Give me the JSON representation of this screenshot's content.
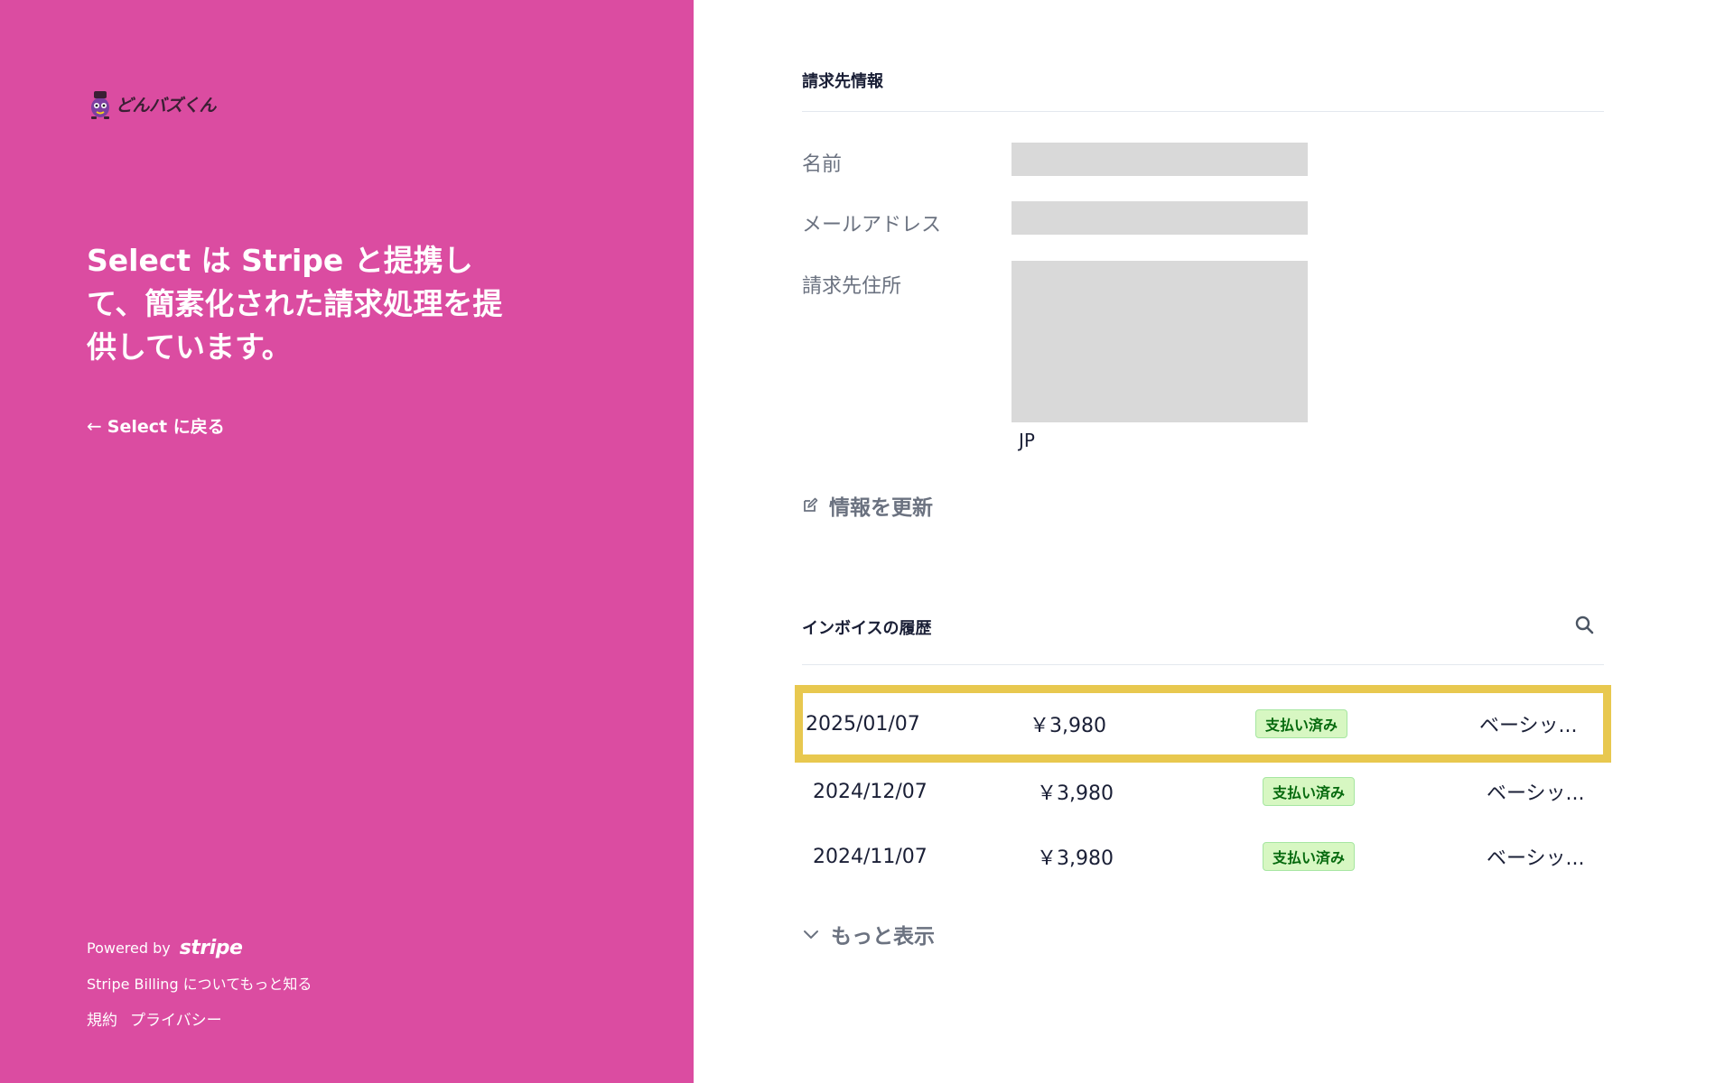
{
  "brand": {
    "logo_text": "どんバズくん",
    "accent_color": "#db4ca1"
  },
  "left": {
    "tagline": "Select は Stripe と提携して、簡素化された請求処理を提供しています。",
    "back_label": "Select に戻る",
    "powered_by": "Powered by",
    "stripe_logo": "stripe",
    "billing_link": "Stripe Billing についてもっと知る",
    "terms": "規約",
    "privacy": "プライバシー"
  },
  "billing_info": {
    "title": "請求先情報",
    "name_label": "名前",
    "email_label": "メールアドレス",
    "address_label": "請求先住所",
    "country": "JP",
    "update_label": "情報を更新"
  },
  "invoices": {
    "title": "インボイスの履歴",
    "search_icon": "search-icon",
    "rows": [
      {
        "date": "2025/01/07",
        "amount": "￥3,980",
        "status": "支払い済み",
        "description": "ベーシッ..."
      },
      {
        "date": "2024/12/07",
        "amount": "￥3,980",
        "status": "支払い済み",
        "description": "ベーシッ..."
      },
      {
        "date": "2024/11/07",
        "amount": "￥3,980",
        "status": "支払い済み",
        "description": "ベーシッ..."
      }
    ],
    "show_more": "もっと表示"
  },
  "colors": {
    "paid_badge_bg": "#d7f7c2",
    "paid_badge_text": "#05690d",
    "highlight_border": "#e8c84f"
  }
}
